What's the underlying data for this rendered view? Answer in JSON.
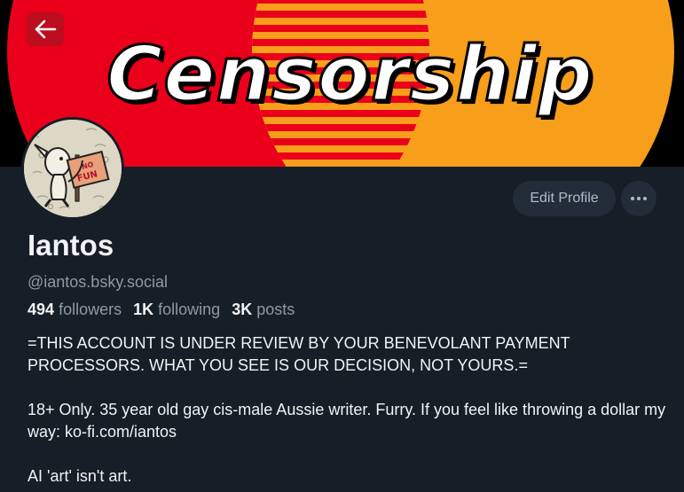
{
  "banner": {
    "title": "Censorship",
    "colors": {
      "left": "#eb001b",
      "right": "#f79e1b",
      "background": "#000000"
    }
  },
  "nav": {
    "back_icon": "arrow-left-icon"
  },
  "profile": {
    "display_name": "Iantos",
    "handle": "@iantos.bsky.social",
    "stats": {
      "followers_count": "494",
      "followers_label": "followers",
      "following_count": "1K",
      "following_label": "following",
      "posts_count": "3K",
      "posts_label": "posts"
    },
    "bio": {
      "line1": "=THIS ACCOUNT IS UNDER REVIEW BY YOUR BENEVOLANT PAYMENT PROCESSORS. WHAT YOU SEE IS OUR DECISION, NOT YOURS.=",
      "line2": "18+ Only. 35 year old gay cis-male Aussie writer. Furry. If you feel like throwing a dollar my way: ko-fi.com/iantos",
      "line3": "AI 'art' isn't art."
    },
    "avatar_sign_text": "NO FUN"
  },
  "actions": {
    "edit_label": "Edit Profile",
    "more_icon": "ellipsis-icon"
  }
}
